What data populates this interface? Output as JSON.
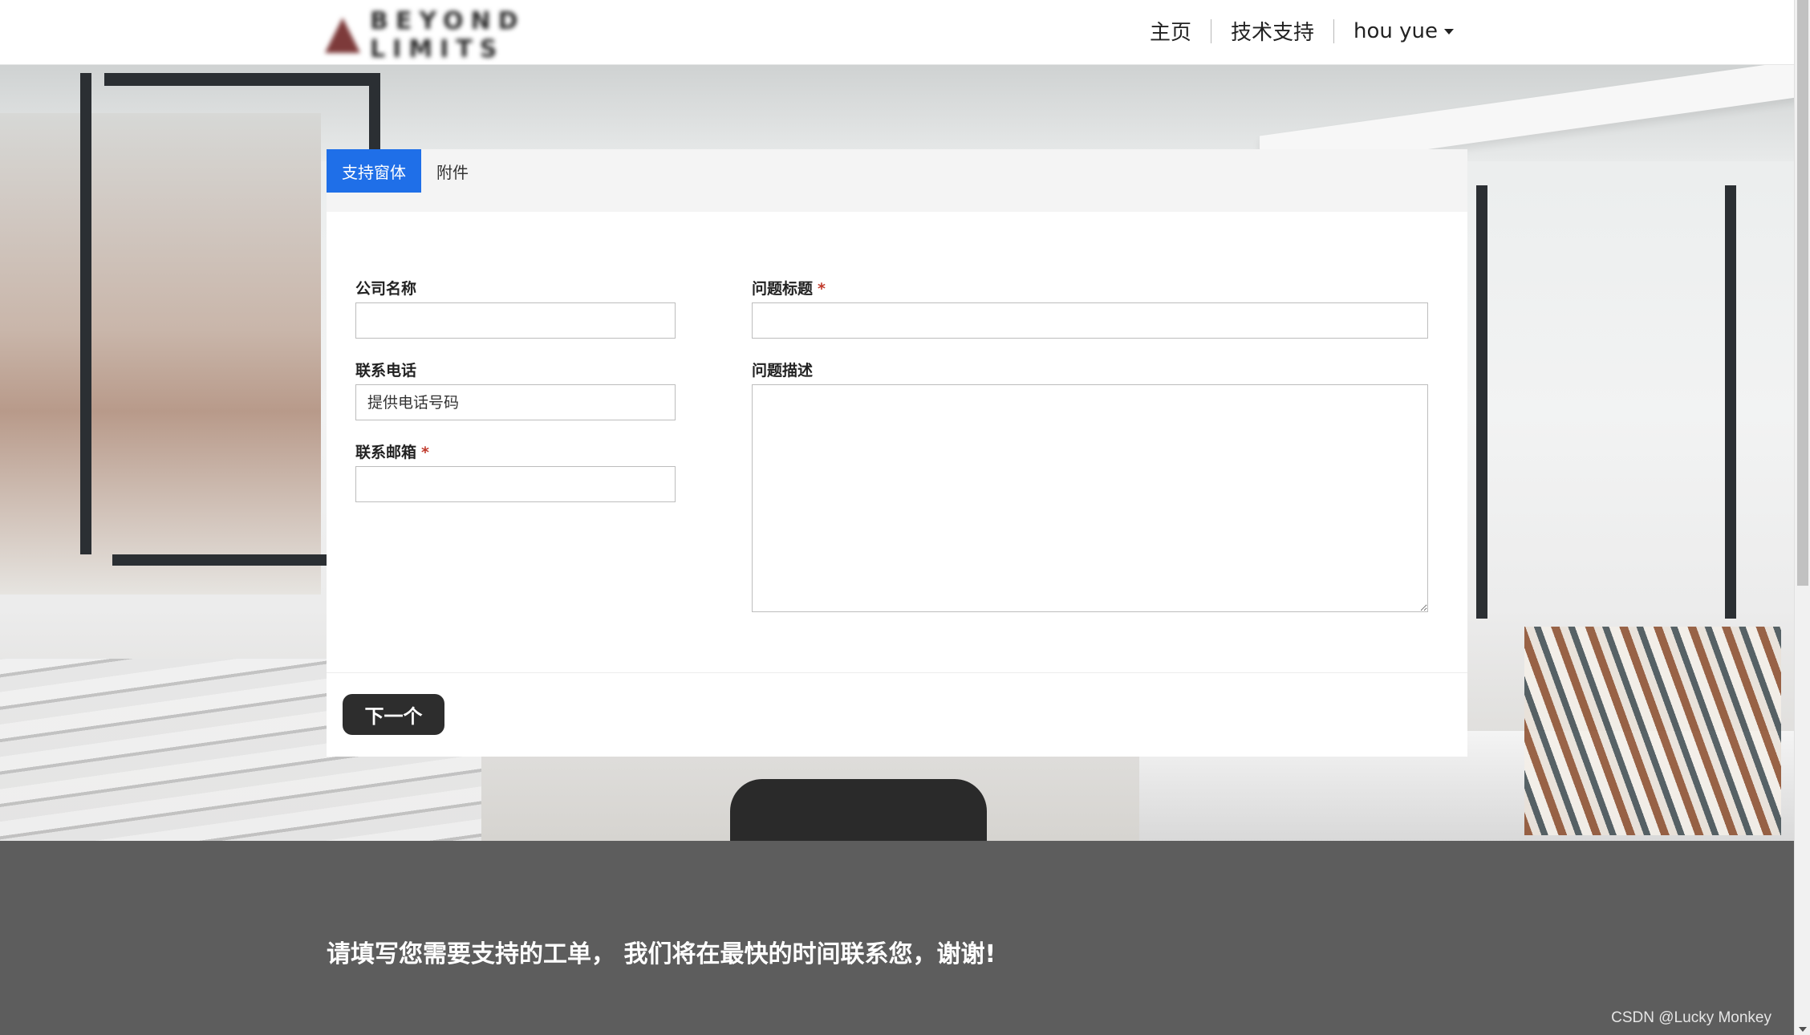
{
  "header": {
    "logo_text": "BEYOND LIMITS",
    "nav": {
      "home": "主页",
      "support": "技术支持",
      "user": "hou yue"
    }
  },
  "tabs": [
    {
      "label": "支持窗体",
      "active": true
    },
    {
      "label": "附件",
      "active": false
    }
  ],
  "form": {
    "company": {
      "label": "公司名称",
      "value": "",
      "required": false
    },
    "phone": {
      "label": "联系电话",
      "placeholder": "提供电话号码",
      "required": false
    },
    "email": {
      "label": "联系邮箱",
      "value": "",
      "required": true
    },
    "subject": {
      "label": "问题标题",
      "value": "",
      "required": true
    },
    "description": {
      "label": "问题描述",
      "value": "",
      "required": false
    },
    "required_mark": "*"
  },
  "buttons": {
    "next": "下一个"
  },
  "footer": {
    "message": "请填写您需要支持的工单， 我们将在最快的时间联系您，谢谢!",
    "watermark": "CSDN @Lucky Monkey"
  },
  "colors": {
    "accent": "#1f6fe8",
    "button_dark": "#2d2d2d",
    "footer_bg": "#5d5d5d",
    "required": "#c0392b"
  }
}
